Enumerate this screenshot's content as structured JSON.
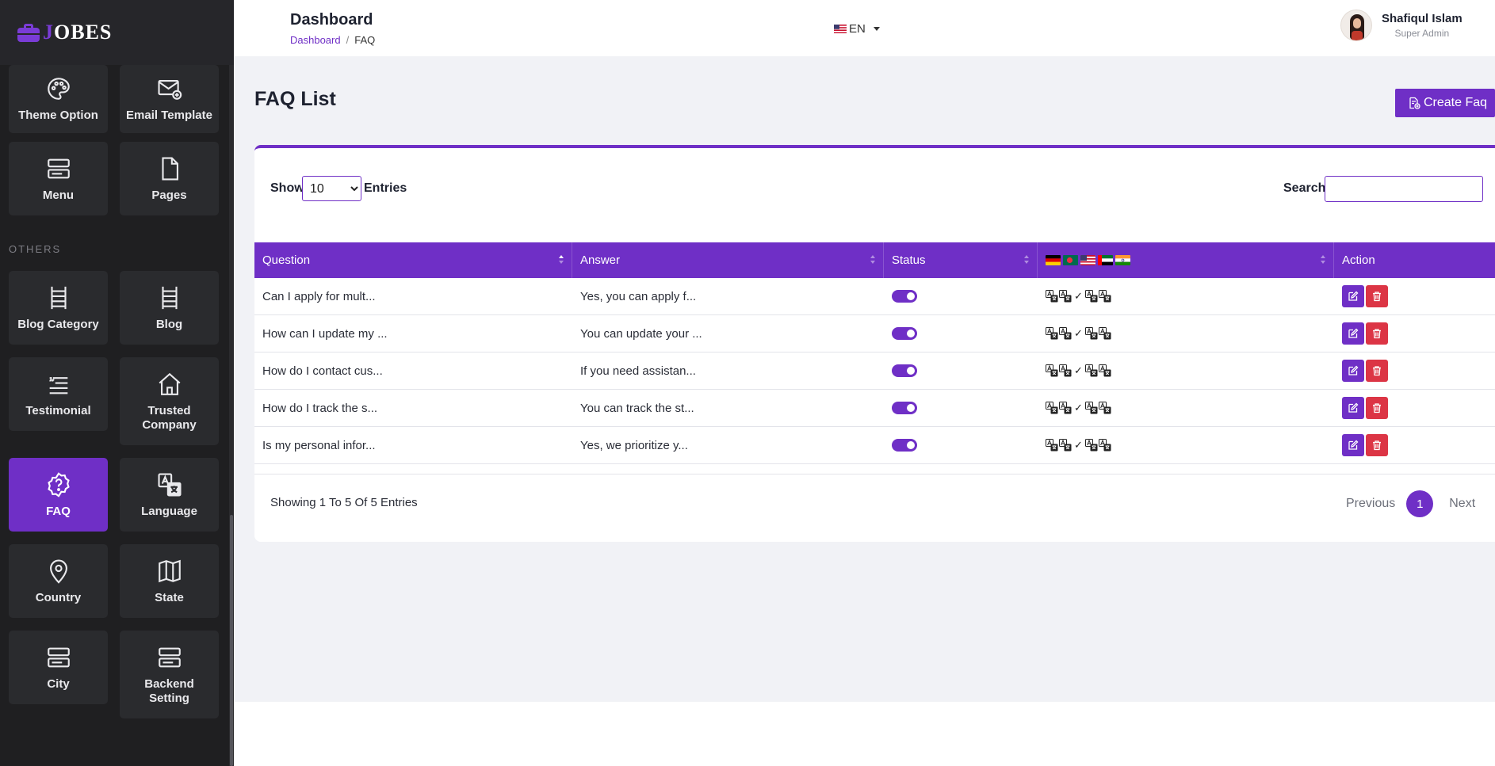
{
  "brand": {
    "name_first": "J",
    "name_rest": "OBES"
  },
  "sidebar": {
    "section_others": "OTHERS",
    "tiles": {
      "theme_option": "Theme Option",
      "email_template": "Email Template",
      "menu": "Menu",
      "pages": "Pages",
      "blog_category": "Blog Category",
      "blog": "Blog",
      "testimonial": "Testimonial",
      "trusted_company": "Trusted Company",
      "faq": "FAQ",
      "language": "Language",
      "country": "Country",
      "state": "State",
      "city": "City",
      "backend_setting": "Backend Setting"
    },
    "active": "faq"
  },
  "header": {
    "title": "Dashboard",
    "breadcrumb": {
      "home": "Dashboard",
      "current": "FAQ"
    },
    "language": "EN",
    "user": {
      "name": "Shafiqul Islam",
      "role": "Super Admin"
    }
  },
  "page": {
    "title": "FAQ List",
    "create_button": "Create Faq",
    "show_label": "Show",
    "entries_label": "Entries",
    "entries_value": "10",
    "search_label": "Search:",
    "search_value": ""
  },
  "table": {
    "headers": {
      "question": "Question",
      "answer": "Answer",
      "status": "Status",
      "action": "Action"
    },
    "rows": [
      {
        "question": "Can I apply for mult...",
        "answer": "Yes, you can apply f..."
      },
      {
        "question": "How can I update my ...",
        "answer": "You can update your ..."
      },
      {
        "question": "How do I contact cus...",
        "answer": "If you need assistan..."
      },
      {
        "question": "How do I track the s...",
        "answer": "You can track the st..."
      },
      {
        "question": "Is my personal infor...",
        "answer": "Yes, we prioritize y..."
      }
    ],
    "check_mark": "✓"
  },
  "pagination": {
    "summary": "Showing 1 To 5 Of 5 Entries",
    "previous": "Previous",
    "current": "1",
    "next": "Next"
  },
  "colors": {
    "accent": "#6f2fc6",
    "danger": "#dc3545",
    "sidebar_bg": "#1f1f21",
    "tile_bg": "#2a2b2e",
    "content_bg": "#f1f2f6"
  }
}
